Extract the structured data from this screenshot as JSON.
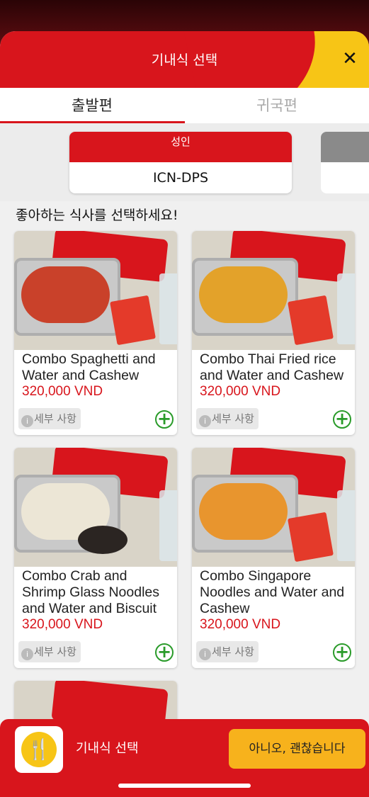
{
  "header": {
    "title": "기내식 선택",
    "close_symbol": "✕"
  },
  "tabs": [
    {
      "label": "출발편",
      "active": true
    },
    {
      "label": "귀국편",
      "active": false
    }
  ],
  "passenger": {
    "type": "성인",
    "route": "ICN-DPS"
  },
  "prompt": "좋아하는 식사를 선택하세요!",
  "meals": [
    {
      "name": "Combo Spaghetti and Water and Cashew",
      "price": "320,000 VND",
      "details_label": "세부 사항",
      "info_icon": "info-icon",
      "add_icon": "plus-circle-icon"
    },
    {
      "name": "Combo Thai Fried rice and Water and Cashew",
      "price": "320,000 VND",
      "details_label": "세부 사항",
      "info_icon": "info-icon",
      "add_icon": "plus-circle-icon"
    },
    {
      "name": "Combo Crab and Shrimp Glass Noodles and Water and Biscuit",
      "price": "320,000 VND",
      "details_label": "세부 사항",
      "info_icon": "info-icon",
      "add_icon": "plus-circle-icon"
    },
    {
      "name": "Combo Singapore Noodles and Water and Cashew",
      "price": "320,000 VND",
      "details_label": "세부 사항",
      "info_icon": "info-icon",
      "add_icon": "plus-circle-icon"
    }
  ],
  "bottom_bar": {
    "label": "기내식 선택",
    "button": "아니오, 괜찮습니다",
    "icon": "meal-icon"
  },
  "colors": {
    "brand_red": "#d8151c",
    "brand_yellow": "#f7c516",
    "price_red": "#d8151c",
    "add_green": "#2a9b2a"
  }
}
